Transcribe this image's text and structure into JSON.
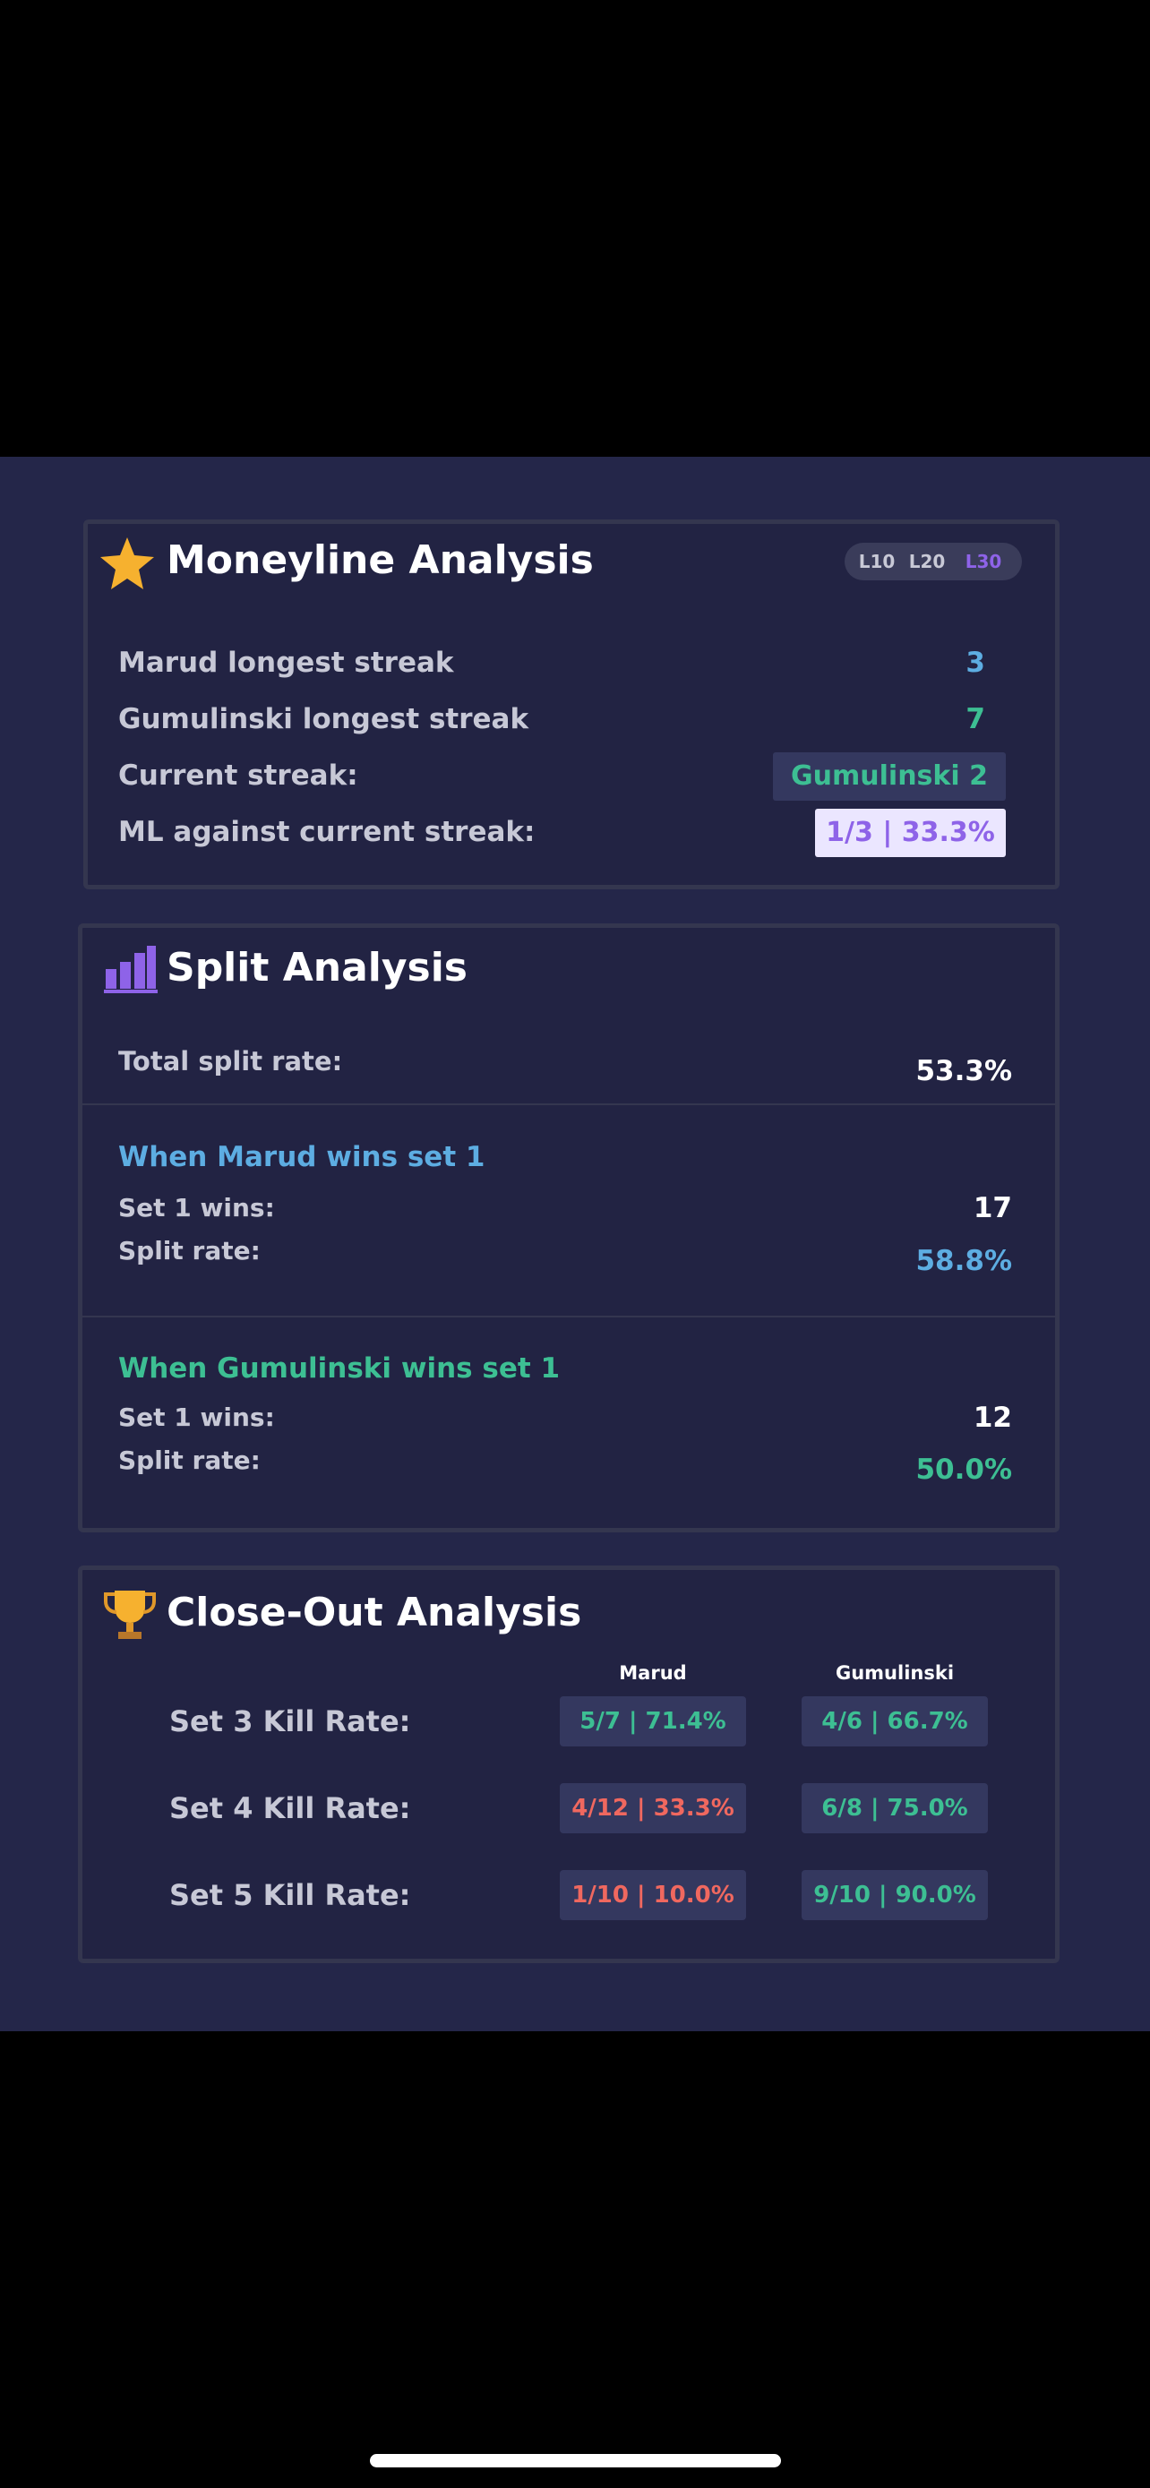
{
  "moneyline": {
    "title": "Moneyline Analysis",
    "tabs": [
      "L10",
      "L20",
      "L30"
    ],
    "active_tab": "L30",
    "rows": [
      {
        "label": "Marud longest streak",
        "value": "3"
      },
      {
        "label": "Gumulinski longest streak",
        "value": "7"
      },
      {
        "label": "Current streak:",
        "value": "Gumulinski 2"
      },
      {
        "label": "ML against current streak:",
        "value": "1/3 | 33.3%"
      }
    ]
  },
  "split": {
    "title": "Split Analysis",
    "total_label": "Total split rate:",
    "total_value": "53.3%",
    "marud": {
      "heading": "When Marud wins set 1",
      "wins_label": "Set 1 wins:",
      "wins_value": "17",
      "rate_label": "Split rate:",
      "rate_value": "58.8%"
    },
    "gumulinski": {
      "heading": "When Gumulinski wins set 1",
      "wins_label": "Set 1 wins:",
      "wins_value": "12",
      "rate_label": "Split rate:",
      "rate_value": "50.0%"
    }
  },
  "closeout": {
    "title": "Close-Out Analysis",
    "columns": [
      "Marud",
      "Gumulinski"
    ],
    "rows": [
      {
        "label": "Set 3 Kill Rate:",
        "marud": "5/7 | 71.4%",
        "gumulinski": "4/6 | 66.7%"
      },
      {
        "label": "Set 4 Kill Rate:",
        "marud": "4/12 | 33.3%",
        "gumulinski": "6/8 | 75.0%"
      },
      {
        "label": "Set 5 Kill Rate:",
        "marud": "1/10 | 10.0%",
        "gumulinski": "9/10 | 90.0%"
      }
    ]
  },
  "colors": {
    "background": "#242649",
    "card": "#222343",
    "blue": "#5dade2",
    "green": "#3dbf93",
    "purple": "#8e63e8",
    "red": "#f0685f",
    "gold": "#f6b12f"
  }
}
